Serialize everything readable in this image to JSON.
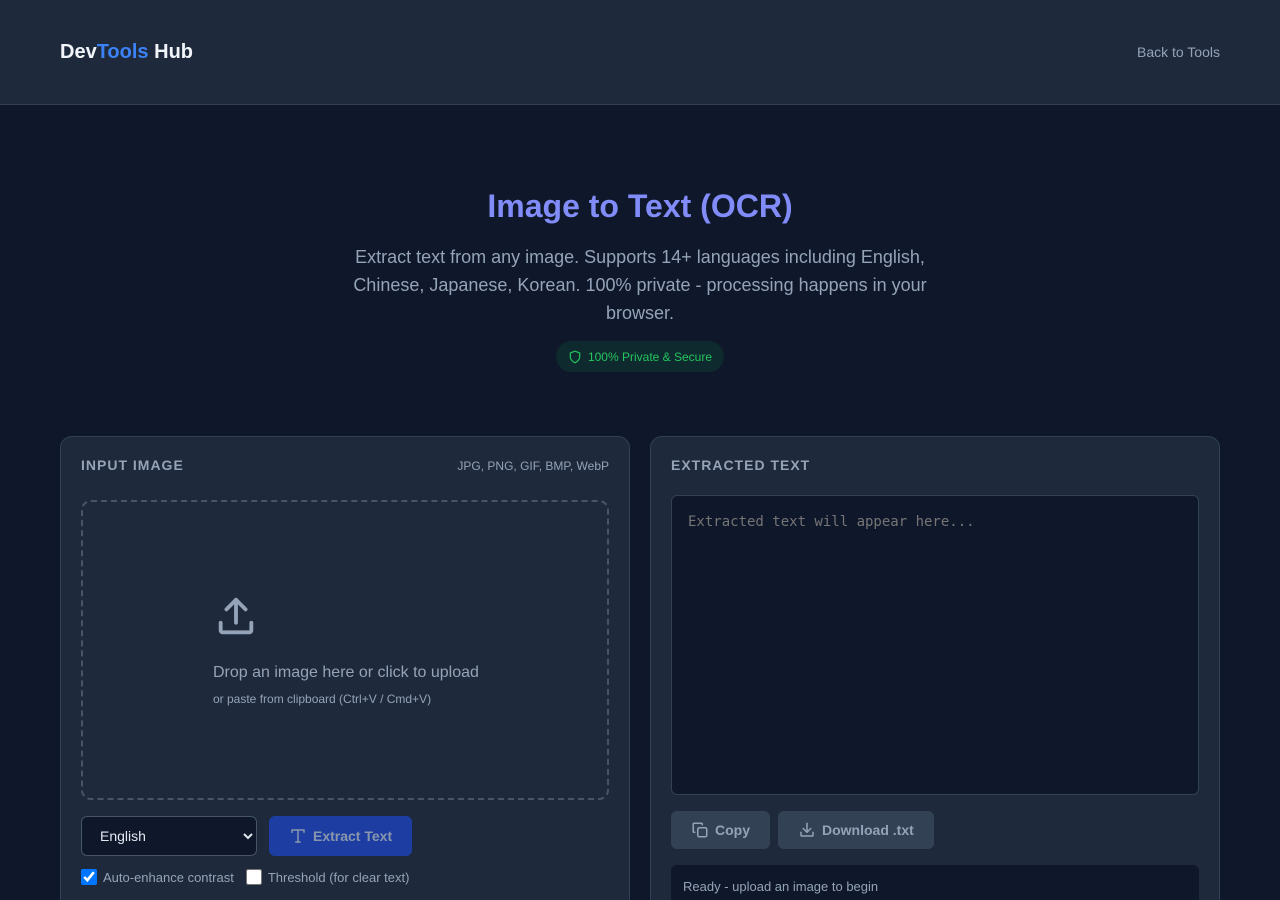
{
  "header": {
    "logo_part1": "Dev",
    "logo_part2": "Tools",
    "logo_part3": " Hub",
    "back_link": "Back to Tools"
  },
  "hero": {
    "title": "Image to Text (OCR)",
    "description": "Extract text from any image. Supports 14+ languages including English, Chinese, Japanese, Korean. 100% private - processing happens in your browser.",
    "badge": "100% Private & Secure"
  },
  "input_panel": {
    "title": "INPUT IMAGE",
    "formats": "JPG, PNG, GIF, BMP, WebP",
    "drop_main": "Drop an image here or click to upload",
    "drop_sub": "or paste from clipboard (Ctrl+V / Cmd+V)",
    "language_selected": "English",
    "extract_label": "Extract Text",
    "auto_enhance_label": "Auto-enhance contrast",
    "auto_enhance_checked": true,
    "threshold_label": "Threshold (for clear text)",
    "threshold_checked": false
  },
  "output_panel": {
    "title": "EXTRACTED TEXT",
    "placeholder": "Extracted text will appear here...",
    "copy_label": "Copy",
    "download_label": "Download .txt",
    "status": "Ready - upload an image to begin"
  },
  "colors": {
    "background": "#0f172a",
    "surface": "#1e293b",
    "accent": "#3b82f6",
    "title": "#818cf8",
    "success": "#22c55e"
  }
}
